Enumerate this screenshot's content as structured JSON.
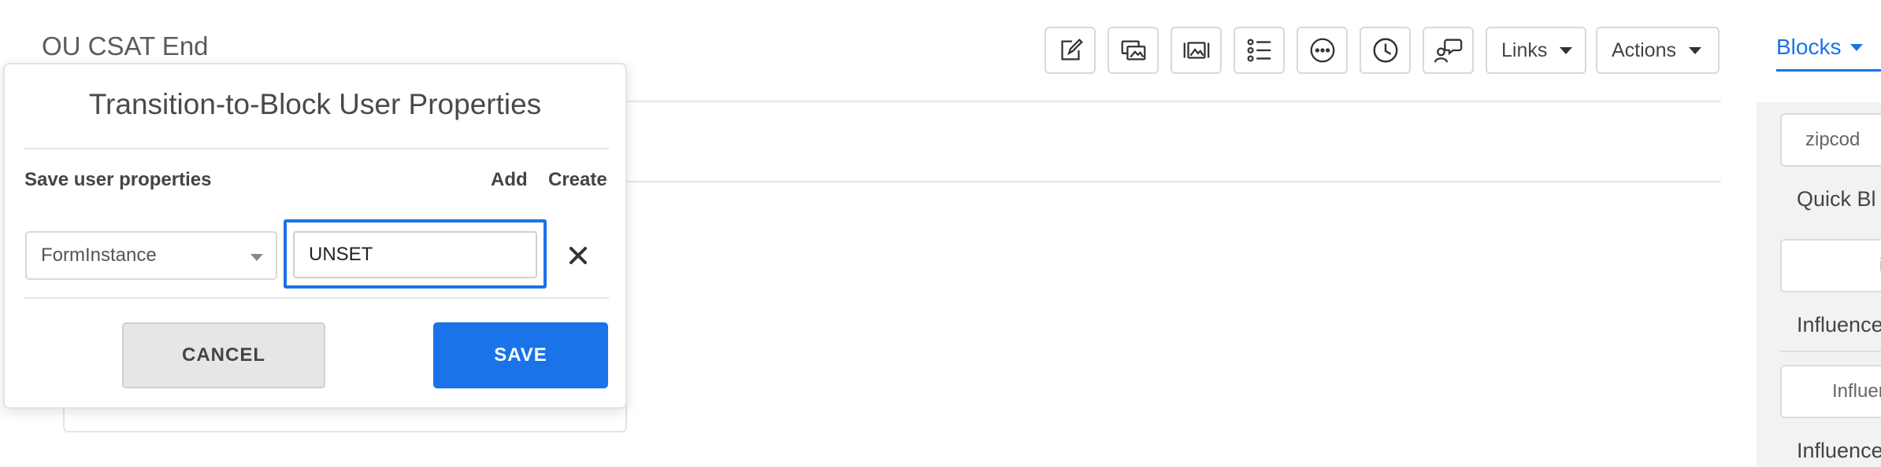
{
  "page": {
    "title": "OU CSAT End"
  },
  "toolbar": {
    "icons": [
      "edit-icon",
      "gallery-icon",
      "media-icon",
      "list-icon",
      "more-icon",
      "clock-icon",
      "chat-user-icon"
    ],
    "links_label": "Links",
    "actions_label": "Actions"
  },
  "right_panel": {
    "tab_label": "Blocks",
    "field1": "zipcod",
    "label1": "Quick Bl",
    "field2": "in",
    "label2": "Influence",
    "field3": "Influen",
    "label3": "Influence"
  },
  "modal": {
    "title": "Transition-to-Block User Properties",
    "save_label": "Save user properties",
    "add_label": "Add",
    "create_label": "Create",
    "property_select_value": "FormInstance",
    "value_input": "UNSET",
    "cancel_label": "CANCEL",
    "save_button_label": "SAVE"
  },
  "colors": {
    "accent": "#1a73e8",
    "border": "#d9d9d9",
    "panel_bg": "#f1f2f4"
  }
}
